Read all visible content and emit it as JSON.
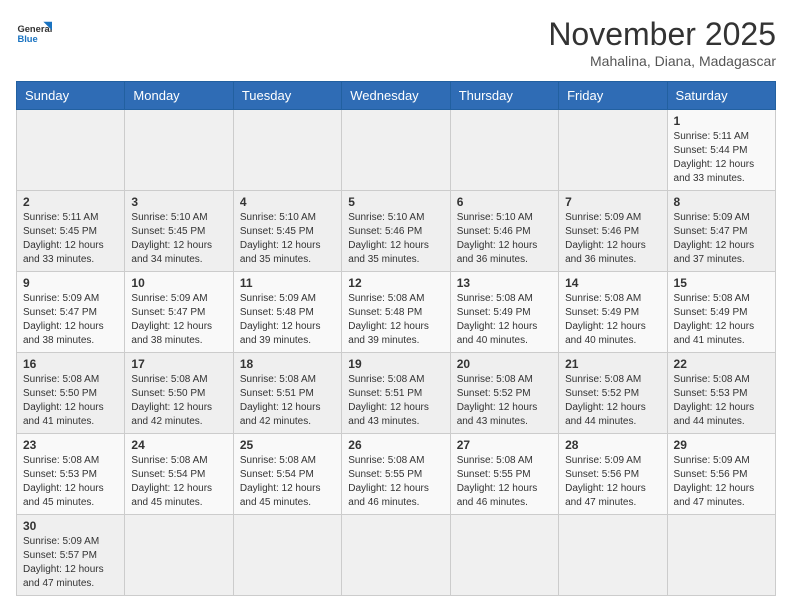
{
  "logo": {
    "text_general": "General",
    "text_blue": "Blue"
  },
  "header": {
    "month_year": "November 2025",
    "location": "Mahalina, Diana, Madagascar"
  },
  "weekdays": [
    "Sunday",
    "Monday",
    "Tuesday",
    "Wednesday",
    "Thursday",
    "Friday",
    "Saturday"
  ],
  "weeks": [
    [
      {
        "day": "",
        "info": ""
      },
      {
        "day": "",
        "info": ""
      },
      {
        "day": "",
        "info": ""
      },
      {
        "day": "",
        "info": ""
      },
      {
        "day": "",
        "info": ""
      },
      {
        "day": "",
        "info": ""
      },
      {
        "day": "1",
        "info": "Sunrise: 5:11 AM\nSunset: 5:44 PM\nDaylight: 12 hours and 33 minutes."
      }
    ],
    [
      {
        "day": "2",
        "info": "Sunrise: 5:11 AM\nSunset: 5:45 PM\nDaylight: 12 hours and 33 minutes."
      },
      {
        "day": "3",
        "info": "Sunrise: 5:10 AM\nSunset: 5:45 PM\nDaylight: 12 hours and 34 minutes."
      },
      {
        "day": "4",
        "info": "Sunrise: 5:10 AM\nSunset: 5:45 PM\nDaylight: 12 hours and 35 minutes."
      },
      {
        "day": "5",
        "info": "Sunrise: 5:10 AM\nSunset: 5:46 PM\nDaylight: 12 hours and 35 minutes."
      },
      {
        "day": "6",
        "info": "Sunrise: 5:10 AM\nSunset: 5:46 PM\nDaylight: 12 hours and 36 minutes."
      },
      {
        "day": "7",
        "info": "Sunrise: 5:09 AM\nSunset: 5:46 PM\nDaylight: 12 hours and 36 minutes."
      },
      {
        "day": "8",
        "info": "Sunrise: 5:09 AM\nSunset: 5:47 PM\nDaylight: 12 hours and 37 minutes."
      }
    ],
    [
      {
        "day": "9",
        "info": "Sunrise: 5:09 AM\nSunset: 5:47 PM\nDaylight: 12 hours and 38 minutes."
      },
      {
        "day": "10",
        "info": "Sunrise: 5:09 AM\nSunset: 5:47 PM\nDaylight: 12 hours and 38 minutes."
      },
      {
        "day": "11",
        "info": "Sunrise: 5:09 AM\nSunset: 5:48 PM\nDaylight: 12 hours and 39 minutes."
      },
      {
        "day": "12",
        "info": "Sunrise: 5:08 AM\nSunset: 5:48 PM\nDaylight: 12 hours and 39 minutes."
      },
      {
        "day": "13",
        "info": "Sunrise: 5:08 AM\nSunset: 5:49 PM\nDaylight: 12 hours and 40 minutes."
      },
      {
        "day": "14",
        "info": "Sunrise: 5:08 AM\nSunset: 5:49 PM\nDaylight: 12 hours and 40 minutes."
      },
      {
        "day": "15",
        "info": "Sunrise: 5:08 AM\nSunset: 5:49 PM\nDaylight: 12 hours and 41 minutes."
      }
    ],
    [
      {
        "day": "16",
        "info": "Sunrise: 5:08 AM\nSunset: 5:50 PM\nDaylight: 12 hours and 41 minutes."
      },
      {
        "day": "17",
        "info": "Sunrise: 5:08 AM\nSunset: 5:50 PM\nDaylight: 12 hours and 42 minutes."
      },
      {
        "day": "18",
        "info": "Sunrise: 5:08 AM\nSunset: 5:51 PM\nDaylight: 12 hours and 42 minutes."
      },
      {
        "day": "19",
        "info": "Sunrise: 5:08 AM\nSunset: 5:51 PM\nDaylight: 12 hours and 43 minutes."
      },
      {
        "day": "20",
        "info": "Sunrise: 5:08 AM\nSunset: 5:52 PM\nDaylight: 12 hours and 43 minutes."
      },
      {
        "day": "21",
        "info": "Sunrise: 5:08 AM\nSunset: 5:52 PM\nDaylight: 12 hours and 44 minutes."
      },
      {
        "day": "22",
        "info": "Sunrise: 5:08 AM\nSunset: 5:53 PM\nDaylight: 12 hours and 44 minutes."
      }
    ],
    [
      {
        "day": "23",
        "info": "Sunrise: 5:08 AM\nSunset: 5:53 PM\nDaylight: 12 hours and 45 minutes."
      },
      {
        "day": "24",
        "info": "Sunrise: 5:08 AM\nSunset: 5:54 PM\nDaylight: 12 hours and 45 minutes."
      },
      {
        "day": "25",
        "info": "Sunrise: 5:08 AM\nSunset: 5:54 PM\nDaylight: 12 hours and 45 minutes."
      },
      {
        "day": "26",
        "info": "Sunrise: 5:08 AM\nSunset: 5:55 PM\nDaylight: 12 hours and 46 minutes."
      },
      {
        "day": "27",
        "info": "Sunrise: 5:08 AM\nSunset: 5:55 PM\nDaylight: 12 hours and 46 minutes."
      },
      {
        "day": "28",
        "info": "Sunrise: 5:09 AM\nSunset: 5:56 PM\nDaylight: 12 hours and 47 minutes."
      },
      {
        "day": "29",
        "info": "Sunrise: 5:09 AM\nSunset: 5:56 PM\nDaylight: 12 hours and 47 minutes."
      }
    ],
    [
      {
        "day": "30",
        "info": "Sunrise: 5:09 AM\nSunset: 5:57 PM\nDaylight: 12 hours and 47 minutes."
      },
      {
        "day": "",
        "info": ""
      },
      {
        "day": "",
        "info": ""
      },
      {
        "day": "",
        "info": ""
      },
      {
        "day": "",
        "info": ""
      },
      {
        "day": "",
        "info": ""
      },
      {
        "day": "",
        "info": ""
      }
    ]
  ]
}
